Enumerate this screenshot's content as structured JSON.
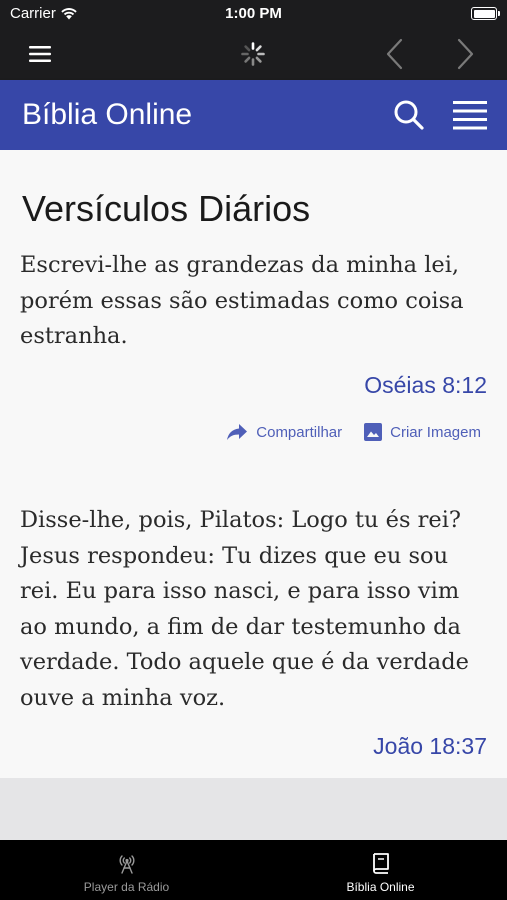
{
  "status_bar": {
    "carrier": "Carrier",
    "time": "1:00 PM"
  },
  "app_bar": {
    "title": "Bíblia Online"
  },
  "content": {
    "heading": "Versículos Diários",
    "verses": [
      {
        "text": "Escrevi-lhe as grandezas da minha lei, porém essas são estimadas como coisa estranha.",
        "reference": "Oséias 8:12"
      },
      {
        "text": "Disse-lhe, pois, Pilatos: Logo tu és rei? Jesus respondeu: Tu dizes que eu sou rei. Eu para isso nasci, e para isso vim ao mundo, a fim de dar testemunho da verdade. Todo aquele que é da verdade ouve a minha voz.",
        "reference": "João 18:37"
      }
    ],
    "actions": {
      "share": "Compartilhar",
      "create_image": "Criar Imagem"
    }
  },
  "tab_bar": {
    "tabs": [
      {
        "label": "Player da Rádio",
        "icon": "radio-tower-icon",
        "active": false
      },
      {
        "label": "Bíblia Online",
        "icon": "book-icon",
        "active": true
      }
    ]
  },
  "colors": {
    "primary": "#3747a8",
    "link": "#4f5fb8",
    "tab_active": "#ffffff",
    "tab_inactive": "#9a9a9a"
  }
}
